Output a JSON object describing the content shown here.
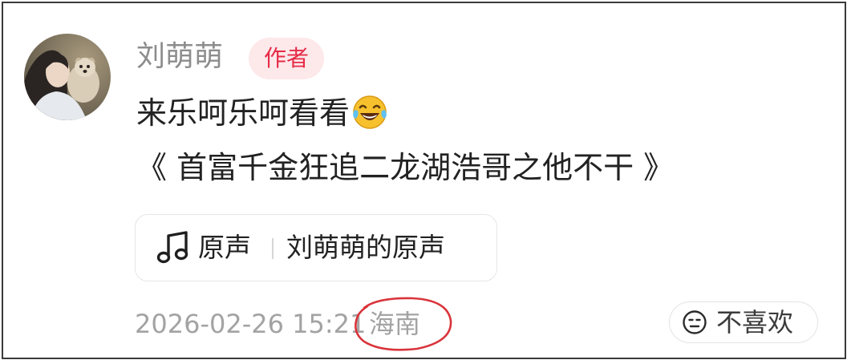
{
  "comment": {
    "author": {
      "name": "刘萌萌",
      "badge": "作者"
    },
    "text_line_1": "来乐呵乐呵看看",
    "text_line_1_emoji": "laughing-tears-emoji",
    "text_line_2": "《 首富千金狂追二龙湖浩哥之他不干 》",
    "music": {
      "icon": "music-note-icon",
      "kind": "原声",
      "title": "刘萌萌的原声"
    },
    "timestamp": "2026-02-26 15:21",
    "location": "海南",
    "dislike_label": "不喜欢",
    "dislike_icon": "neutral-face-icon"
  },
  "colors": {
    "badge_text": "#e52b47",
    "badge_background": "#fde8ea",
    "annotation_circle": "#d9343b",
    "meta_text": "#a3a3a3"
  }
}
